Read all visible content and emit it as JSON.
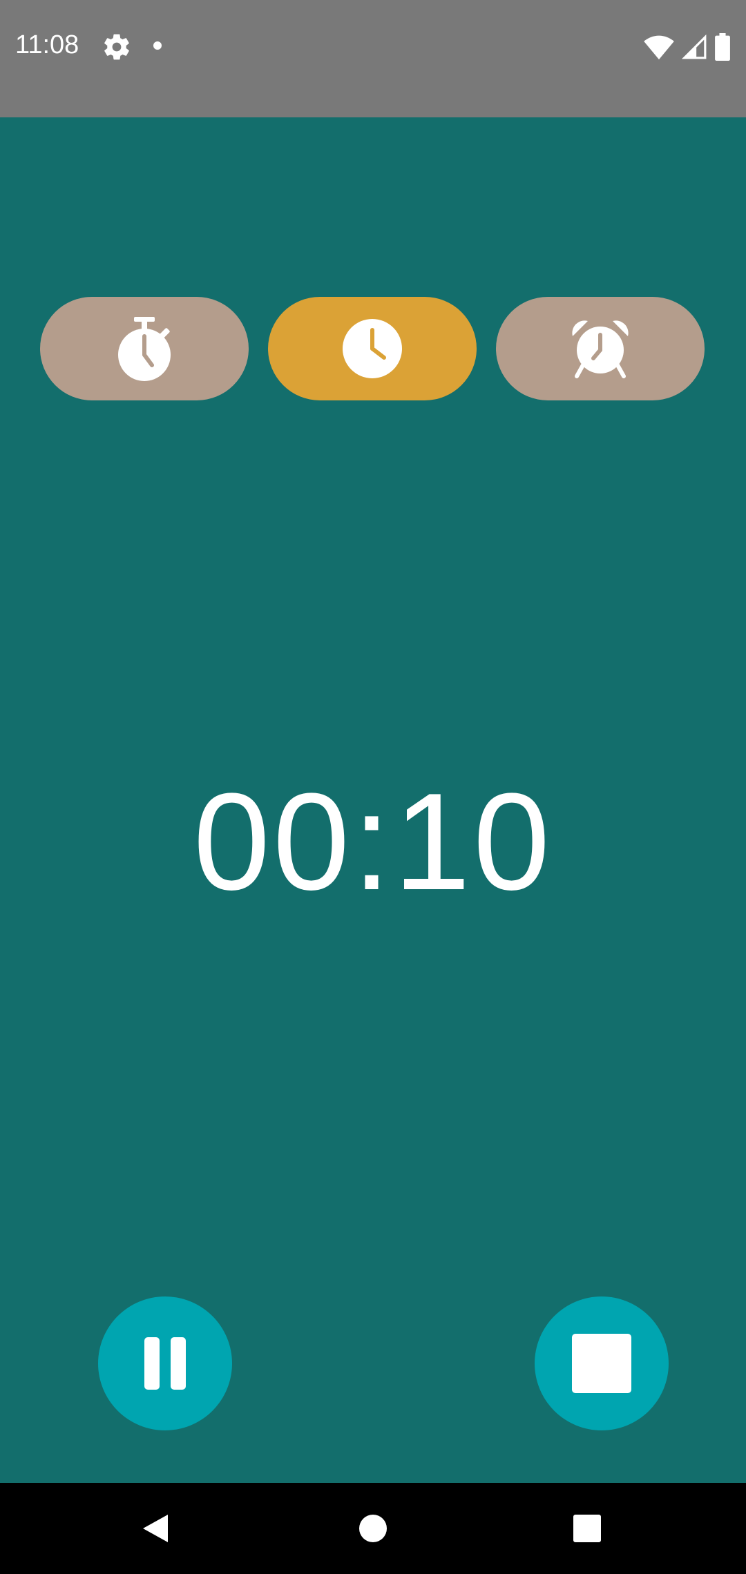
{
  "status_bar": {
    "time": "11:08",
    "icons": [
      "gear-icon",
      "notification-dot",
      "wifi-icon",
      "cell-signal-icon",
      "battery-icon"
    ]
  },
  "modes": {
    "items": [
      {
        "name": "stopwatch",
        "icon": "stopwatch-icon",
        "selected": false
      },
      {
        "name": "timer",
        "icon": "clock-icon",
        "selected": true
      },
      {
        "name": "alarm",
        "icon": "alarm-clock-icon",
        "selected": false
      }
    ],
    "colors": {
      "selected": "#dba236",
      "unselected": "#b49d8c"
    }
  },
  "timer": {
    "display": "00:10"
  },
  "controls": {
    "pause_icon": "pause-icon",
    "stop_icon": "stop-icon",
    "button_color": "#00a5b0"
  },
  "nav": {
    "icons": [
      "back-icon",
      "home-icon",
      "recents-icon"
    ]
  },
  "colors": {
    "background": "#136e6c",
    "status_bar": "#797979",
    "nav_bar": "#000000"
  }
}
